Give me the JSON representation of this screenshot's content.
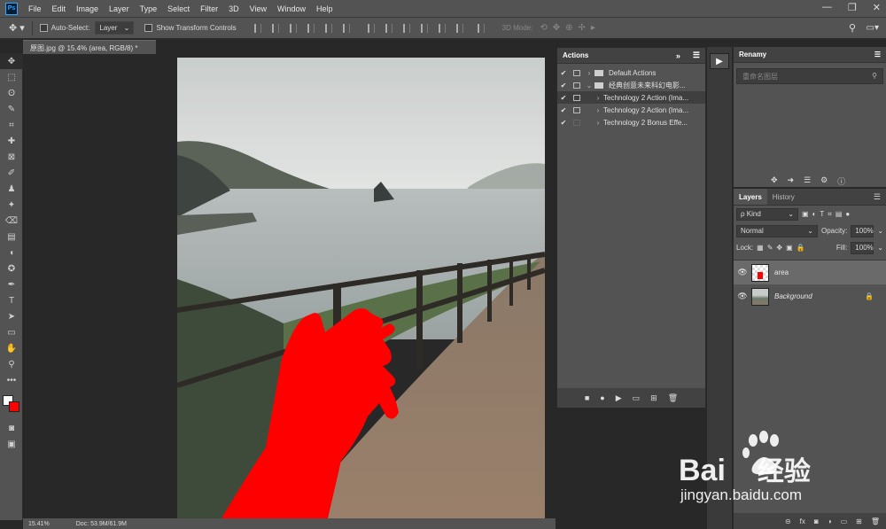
{
  "menubar": {
    "logo": "Ps",
    "items": [
      "File",
      "Edit",
      "Image",
      "Layer",
      "Type",
      "Select",
      "Filter",
      "3D",
      "View",
      "Window",
      "Help"
    ],
    "window_controls": [
      "—",
      "❐",
      "✕"
    ]
  },
  "options": {
    "auto_select_label": "Auto-Select:",
    "auto_select_value": "Layer",
    "show_transform_label": "Show Transform Controls",
    "mode_3d_label": "3D Mode:"
  },
  "document": {
    "tab_title": "原图.jpg @ 15.4% (area, RGB/8) *",
    "zoom": "15.41%",
    "doc_info": "Doc: 53.9M/61.9M"
  },
  "tools": [
    "✥",
    "⬚",
    "ʘ",
    "✎",
    "⌗",
    "✚",
    "⊠",
    "✐",
    "♟",
    "✦",
    "⌫",
    "▤",
    "◖",
    "✪",
    "✒",
    "T",
    "➤",
    "▭",
    "✋",
    "⚲",
    "•••"
  ],
  "actions": {
    "title": "Actions",
    "rows": [
      {
        "check": "✔",
        "arrow": "›",
        "name": "Default Actions",
        "level": 0,
        "folder": true
      },
      {
        "check": "✔",
        "arrow": "⌄",
        "name": "经典创意未来科幻电影...",
        "level": 0,
        "folder": true
      },
      {
        "check": "✔",
        "arrow": "›",
        "name": "Technology 2 Action (Ima...",
        "level": 1,
        "folder": false
      },
      {
        "check": "✔",
        "arrow": "›",
        "name": "Technology 2 Action (Ima...",
        "level": 1,
        "folder": false
      },
      {
        "check": "✔",
        "arrow": "›",
        "name": "Technology 2 Bonus Effe...",
        "level": 1,
        "folder": false
      }
    ],
    "footer": [
      "■",
      "●",
      "▶",
      "▭",
      "⊞",
      "🗑"
    ]
  },
  "rename": {
    "title": "Renamy",
    "placeholder": "重命名图层",
    "icons": [
      "✥",
      "➜",
      "☰",
      "⚙",
      "ⓘ"
    ]
  },
  "layers": {
    "tabs": [
      "Layers",
      "History"
    ],
    "filter_label": "ρ Kind",
    "blend_mode": "Normal",
    "opacity_label": "Opacity:",
    "opacity_value": "100%",
    "lock_label": "Lock:",
    "fill_label": "Fill:",
    "fill_value": "100%",
    "items": [
      {
        "name": "area",
        "selected": true,
        "locked": false
      },
      {
        "name": "Background",
        "selected": false,
        "locked": true
      }
    ],
    "footer": [
      "⊝",
      "fx",
      "◙",
      "◑",
      "▭",
      "⊞",
      "🗑"
    ]
  },
  "watermark": {
    "brand": "Bai",
    "brand2": "经验",
    "url": "jingyan.baidu.com"
  },
  "colors": {
    "accent_red": "#ff0000",
    "panel": "#535353",
    "dark": "#282828"
  }
}
